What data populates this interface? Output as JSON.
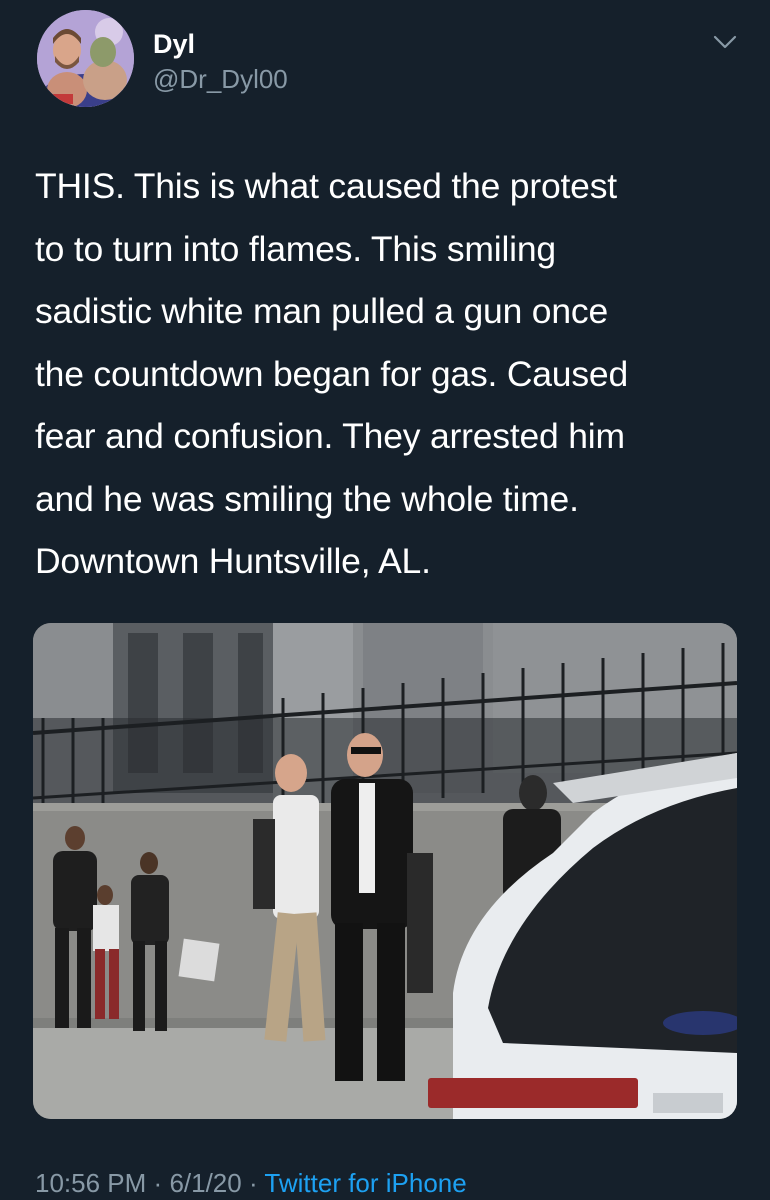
{
  "user": {
    "display_name": "Dyl",
    "handle": "@Dr_Dyl00"
  },
  "tweet": {
    "lines": [
      "THIS. This is what caused the protest",
      "to to turn into flames. This smiling",
      "sadistic white man pulled a gun once",
      "the countdown began for gas. Caused",
      "fear and confusion. They arrested him",
      "and he was smiling the whole time.",
      "Downtown Huntsville, AL."
    ]
  },
  "meta": {
    "time": "10:56 PM",
    "separator": "·",
    "date": "6/1/20",
    "source": "Twitter for iPhone"
  },
  "icons": {
    "menu": "chevron-down-icon"
  },
  "colors": {
    "background": "#15202b",
    "primary_text": "#ffffff",
    "secondary_text": "#8899a6",
    "link": "#1da1f2"
  }
}
